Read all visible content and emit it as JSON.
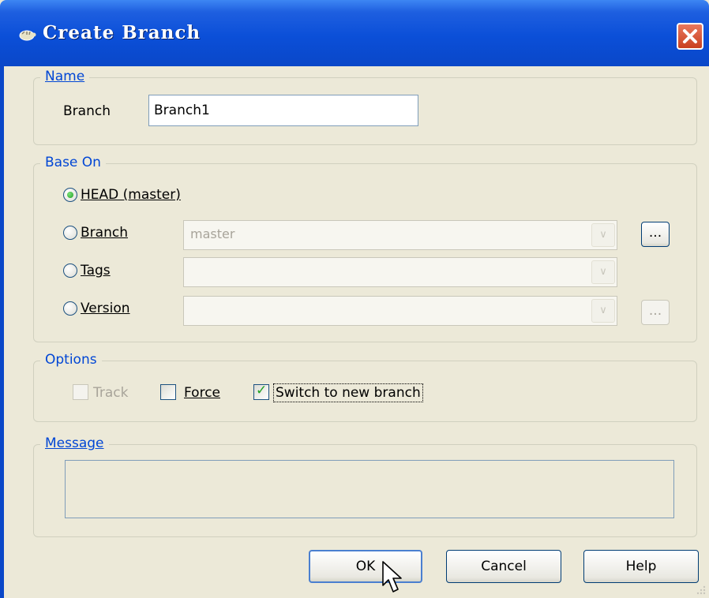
{
  "window": {
    "title": "Create Branch",
    "title_icon": "tortoise-icon",
    "close_icon": "close-icon"
  },
  "name_group": {
    "legend": "Name",
    "branch_label": "Branch",
    "branch_value": "Branch1"
  },
  "base_on": {
    "legend": "Base On",
    "head": {
      "label": "HEAD (master)",
      "checked": true
    },
    "branch": {
      "label": "Branch",
      "checked": false,
      "combo_value": "master",
      "browse_label": "..."
    },
    "tags": {
      "label": "Tags",
      "checked": false,
      "combo_value": ""
    },
    "version": {
      "label": "Version",
      "checked": false,
      "combo_value": "",
      "browse_label": "..."
    }
  },
  "options": {
    "legend": "Options",
    "track": {
      "label": "Track",
      "checked": false,
      "enabled": false
    },
    "force": {
      "label": "Force",
      "checked": false
    },
    "switch": {
      "label": "Switch to new branch",
      "checked": true
    }
  },
  "message": {
    "legend": "Message",
    "value": ""
  },
  "buttons": {
    "ok": "OK",
    "cancel": "Cancel",
    "help": "Help"
  },
  "colors": {
    "titlebar": "#0a47c8",
    "legend_text": "#0046d5",
    "dialog_bg": "#ece9d8",
    "check_green": "#21a121"
  }
}
